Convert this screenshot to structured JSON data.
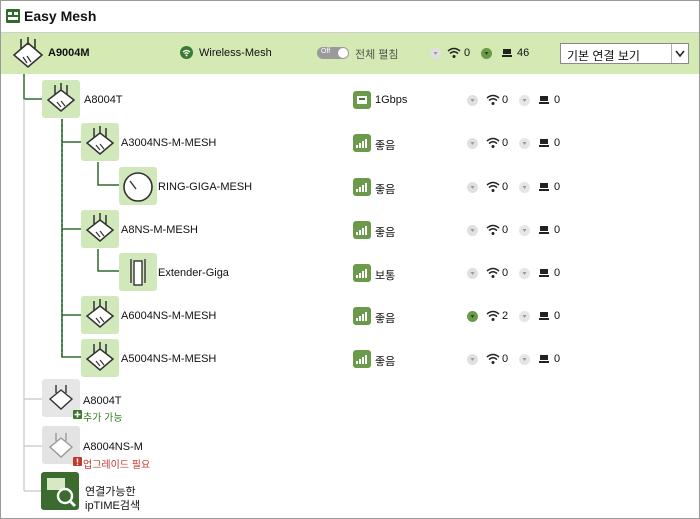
{
  "window": {
    "title": "Easy Mesh"
  },
  "controller": {
    "name": "A9004M",
    "ssid": "Wireless-Mesh",
    "toggle_state": "Off",
    "toggle_label": "전체 펼침",
    "wifi_count": "0",
    "wired_count": "46",
    "view_select": "기본 연결 보기",
    "icons": {
      "ssid": "wifi-circle-icon",
      "wifi": "wifi-icon",
      "wired": "pc-icon"
    }
  },
  "nodes": [
    {
      "name": "A8004T",
      "link": "1Gbps",
      "link_type": "ethernet",
      "wifi": "0",
      "wired": "0",
      "wifi_active": false,
      "icon": "router-icon"
    },
    {
      "name": "A3004NS-M-MESH",
      "link": "좋음",
      "link_type": "signal",
      "wifi": "0",
      "wired": "0",
      "wifi_active": false,
      "icon": "router-icon"
    },
    {
      "name": "RING-GIGA-MESH",
      "link": "좋음",
      "link_type": "signal",
      "wifi": "0",
      "wired": "0",
      "wifi_active": false,
      "icon": "ring-router-icon"
    },
    {
      "name": "A8NS-M-MESH",
      "link": "좋음",
      "link_type": "signal",
      "wifi": "0",
      "wired": "0",
      "wifi_active": false,
      "icon": "router-icon"
    },
    {
      "name": "Extender-Giga",
      "link": "보통",
      "link_type": "signal",
      "wifi": "0",
      "wired": "0",
      "wifi_active": false,
      "icon": "extender-icon"
    },
    {
      "name": "A6004NS-M-MESH",
      "link": "좋음",
      "link_type": "signal",
      "wifi": "2",
      "wired": "0",
      "wifi_active": true,
      "icon": "router-icon"
    },
    {
      "name": "A5004NS-M-MESH",
      "link": "좋음",
      "link_type": "signal",
      "wifi": "0",
      "wired": "0",
      "wifi_active": false,
      "icon": "router-icon"
    }
  ],
  "available": [
    {
      "name": "A8004T",
      "hint": "추가 가능",
      "hint_type": "add",
      "icon": "router-icon"
    },
    {
      "name": "A8004NS-M",
      "hint": "업그레이드 필요",
      "hint_type": "warn",
      "icon": "router-icon"
    }
  ],
  "search": {
    "line1": "연결가능한",
    "line2": "ipTIME검색",
    "icon": "search-icon"
  },
  "colors": {
    "accent": "#2f6b2f",
    "header_bg": "#d4e9b4",
    "line": "#2f6b2f",
    "add": "#3a7a2a",
    "warn": "#c0392b"
  }
}
